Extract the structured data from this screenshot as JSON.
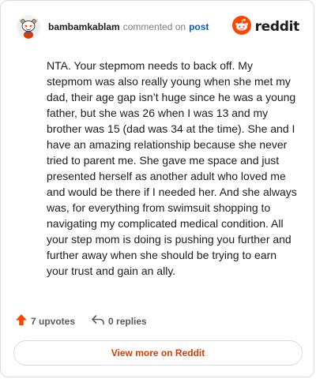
{
  "header": {
    "username": "bambamkablam",
    "action_text": "commented on",
    "post_link": "post",
    "brand": "reddit",
    "avatar_icon": "snoo-avatar-icon",
    "logo_icon": "reddit-snoo-icon"
  },
  "comment": {
    "text": "NTA. Your stepmom needs to back off. My stepmom was also really young when she met my dad, their age gap isn’t huge since he was a young father, but she was 26 when I was 13 and my brother was 15 (dad was 34 at the time). She and I have an amazing relationship because she never tried to parent me. She gave me space and just presented herself as another adult who loved me and would be there if I needed her. And she always was, for everything from swimsuit shopping to navigating my complicated medical condition. All your step mom is doing is pushing you further and further away when she should be trying to earn your trust and gain an ally."
  },
  "actions": {
    "upvotes": "7 upvotes",
    "replies": "0 replies",
    "upvote_icon": "upvote-arrow-icon",
    "reply_icon": "reply-arrow-icon"
  },
  "footer": {
    "view_more": "View more on Reddit"
  },
  "colors": {
    "brand_orange": "#ff4500",
    "link_blue": "#0a5bb8",
    "view_more_text": "#d93a00",
    "border": "#d9dbdd"
  }
}
